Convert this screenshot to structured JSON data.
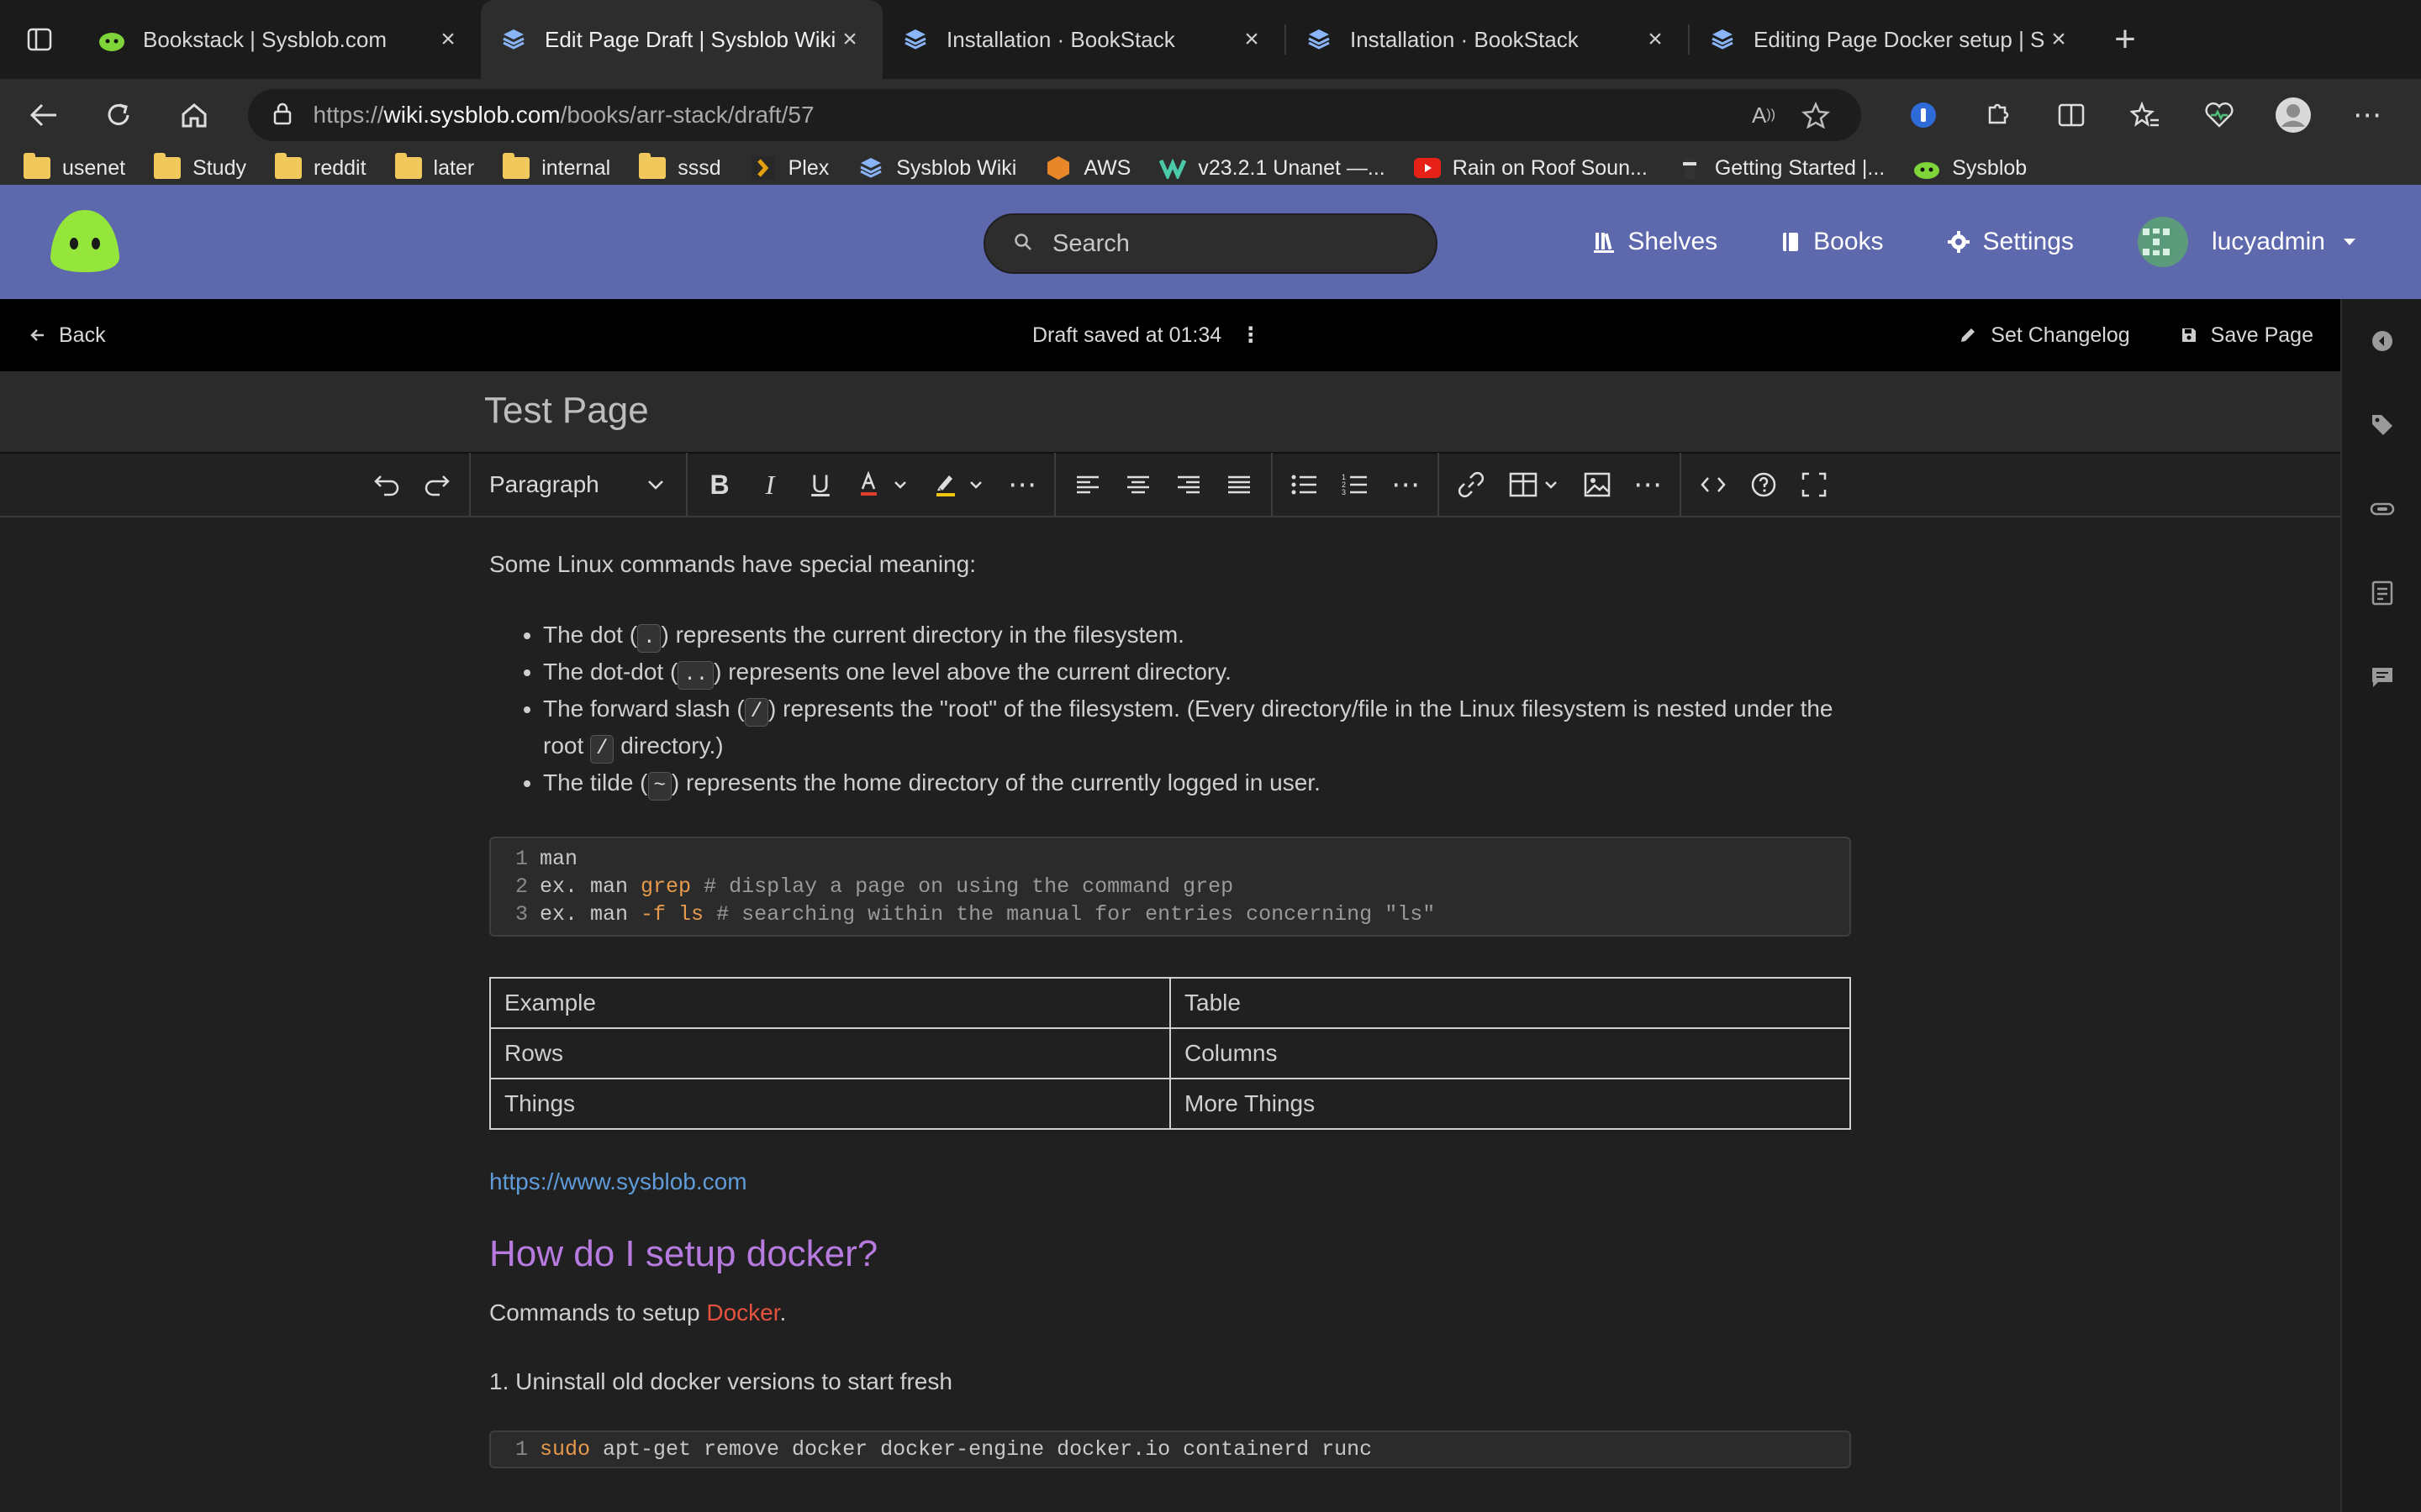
{
  "browser": {
    "tabs": [
      {
        "title": "Bookstack | Sysblob.com",
        "active": false,
        "icon": "bookstack-green-icon"
      },
      {
        "title": "Edit Page Draft | Sysblob Wiki",
        "active": true,
        "icon": "bookstack-blue-icon"
      },
      {
        "title": "Installation · BookStack",
        "active": false,
        "icon": "bookstack-blue-icon"
      },
      {
        "title": "Installation · BookStack",
        "active": false,
        "icon": "bookstack-blue-icon"
      },
      {
        "title": "Editing Page Docker setup | Sy",
        "active": false,
        "icon": "bookstack-blue-icon"
      }
    ],
    "url_prefix": "https://",
    "url_host": "wiki.sysblob.com",
    "url_path": "/books/arr-stack/draft/57",
    "bookmarks": [
      {
        "label": "usenet",
        "icon": "folder-icon"
      },
      {
        "label": "Study",
        "icon": "folder-icon"
      },
      {
        "label": "reddit",
        "icon": "folder-icon"
      },
      {
        "label": "later",
        "icon": "folder-icon"
      },
      {
        "label": "internal",
        "icon": "folder-icon"
      },
      {
        "label": "sssd",
        "icon": "folder-icon"
      },
      {
        "label": "Plex",
        "icon": "plex-icon"
      },
      {
        "label": "Sysblob Wiki",
        "icon": "bookstack-icon"
      },
      {
        "label": "AWS",
        "icon": "aws-icon"
      },
      {
        "label": "v23.2.1 Unanet —...",
        "icon": "unanet-icon"
      },
      {
        "label": "Rain on Roof Soun...",
        "icon": "youtube-icon"
      },
      {
        "label": "Getting Started |...",
        "icon": "ninja-icon"
      },
      {
        "label": "Sysblob",
        "icon": "bookstack-green-icon"
      }
    ]
  },
  "header": {
    "search_placeholder": "Search",
    "nav": {
      "shelves": "Shelves",
      "books": "Books",
      "settings": "Settings",
      "user": "lucyadmin"
    },
    "colors": {
      "header_bg": "#5d68ad",
      "link": "#5f9bd8",
      "heading": "#b77be0",
      "docker": "#e5533f"
    }
  },
  "editor": {
    "back": "Back",
    "draft_status": "Draft saved at 01:34",
    "set_changelog": "Set Changelog",
    "save_page": "Save Page",
    "page_title": "Test Page",
    "block_format": "Paragraph"
  },
  "content": {
    "intro": "Some Linux commands have special meaning:",
    "bullets": [
      {
        "pre": "The dot (",
        "code": ".",
        "post": ") represents the current directory in the filesystem."
      },
      {
        "pre": "The dot-dot (",
        "code": "..",
        "post": ") represents one level above the current directory."
      },
      {
        "pre": "The forward slash (",
        "code": "/",
        "post": ") represents the \"root\" of the filesystem. (Every directory/file in the Linux filesystem is nested under the root ",
        "code2": "/",
        "post2": " directory.)"
      },
      {
        "pre": "The tilde (",
        "code": "~",
        "post": ") represents the home directory of the currently logged in user."
      }
    ],
    "code1": [
      {
        "n": "1",
        "a": "man",
        "kw": "",
        "b": "",
        "cm": ""
      },
      {
        "n": "2",
        "a": "ex. man ",
        "kw": "grep",
        "b": " ",
        "cm": "# display a page on using the command grep"
      },
      {
        "n": "3",
        "a": "ex. man ",
        "kw": "-f ls",
        "b": " ",
        "cm": "# searching within the manual for entries concerning \"ls\""
      }
    ],
    "table": [
      [
        "Example",
        "Table"
      ],
      [
        "Rows",
        "Columns"
      ],
      [
        "Things",
        "More Things"
      ]
    ],
    "link": "https://www.sysblob.com",
    "heading": "How do I setup docker?",
    "cmds_pre": "Commands to setup ",
    "cmds_link": "Docker",
    "cmds_post": ".",
    "step1": "1. Uninstall old docker versions to start fresh",
    "code2": {
      "n": "1",
      "kw": "sudo",
      "rest": " apt-get remove docker docker-engine docker.io containerd runc"
    }
  }
}
